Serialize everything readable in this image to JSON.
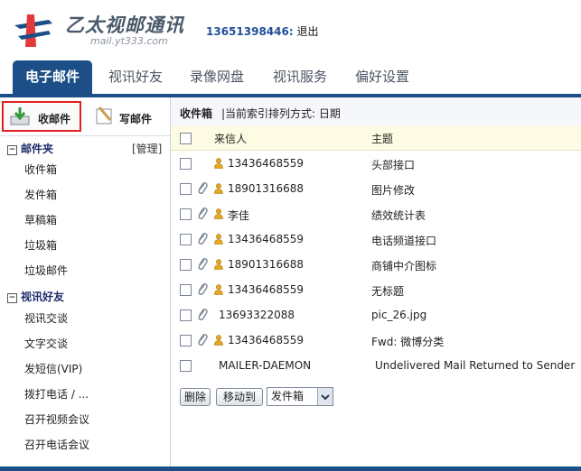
{
  "header": {
    "title": "乙太视邮通讯",
    "subtitle": "mail.yt333.com",
    "user_phone": "13651398446:",
    "logout": "退出"
  },
  "tabs": [
    {
      "label": "电子邮件",
      "active": true
    },
    {
      "label": "视讯好友",
      "active": false
    },
    {
      "label": "录像网盘",
      "active": false
    },
    {
      "label": "视讯服务",
      "active": false
    },
    {
      "label": "偏好设置",
      "active": false
    }
  ],
  "sidebar": {
    "inbox_button": "收邮件",
    "compose_button": "写邮件",
    "folders_header": "邮件夹",
    "manage_link": "[管理]",
    "folders": [
      "收件箱",
      "发件箱",
      "草稿箱",
      "垃圾箱",
      "垃圾邮件"
    ],
    "friends_header": "视讯好友",
    "friends_items": [
      "视讯交谈",
      "文字交谈",
      "发短信(VIP)",
      "拨打电话 / ...",
      "召开视频会议",
      "召开电话会议"
    ]
  },
  "mail": {
    "title": "收件箱",
    "sort_text": "|当前索引排列方式: 日期",
    "col_from": "来信人",
    "col_subject": "主题",
    "rows": [
      {
        "from": "13436468559",
        "subject": "头部接口",
        "attach": false,
        "contact": true
      },
      {
        "from": "18901316688",
        "subject": "图片修改",
        "attach": true,
        "contact": true
      },
      {
        "from": "李佳",
        "subject": "绩效统计表",
        "attach": true,
        "contact": true
      },
      {
        "from": "13436468559",
        "subject": "电话频道接口",
        "attach": true,
        "contact": true
      },
      {
        "from": "18901316688",
        "subject": "商铺中介图标",
        "attach": true,
        "contact": true
      },
      {
        "from": "13436468559",
        "subject": "无标题",
        "attach": true,
        "contact": true
      },
      {
        "from": "13693322088",
        "subject": "pic_26.jpg",
        "attach": true,
        "contact": false
      },
      {
        "from": "13436468559",
        "subject": "Fwd: 微博分类",
        "attach": true,
        "contact": true
      },
      {
        "from": "MAILER-DAEMON",
        "subject": "Undelivered Mail Returned to Sender",
        "attach": false,
        "contact": false
      }
    ],
    "delete_button": "删除",
    "move_button": "移动到",
    "move_target": "发件箱"
  },
  "colors": {
    "brand": "#1c4f87",
    "highlight_border": "#e02020",
    "header_row": "#fdfbe3"
  }
}
